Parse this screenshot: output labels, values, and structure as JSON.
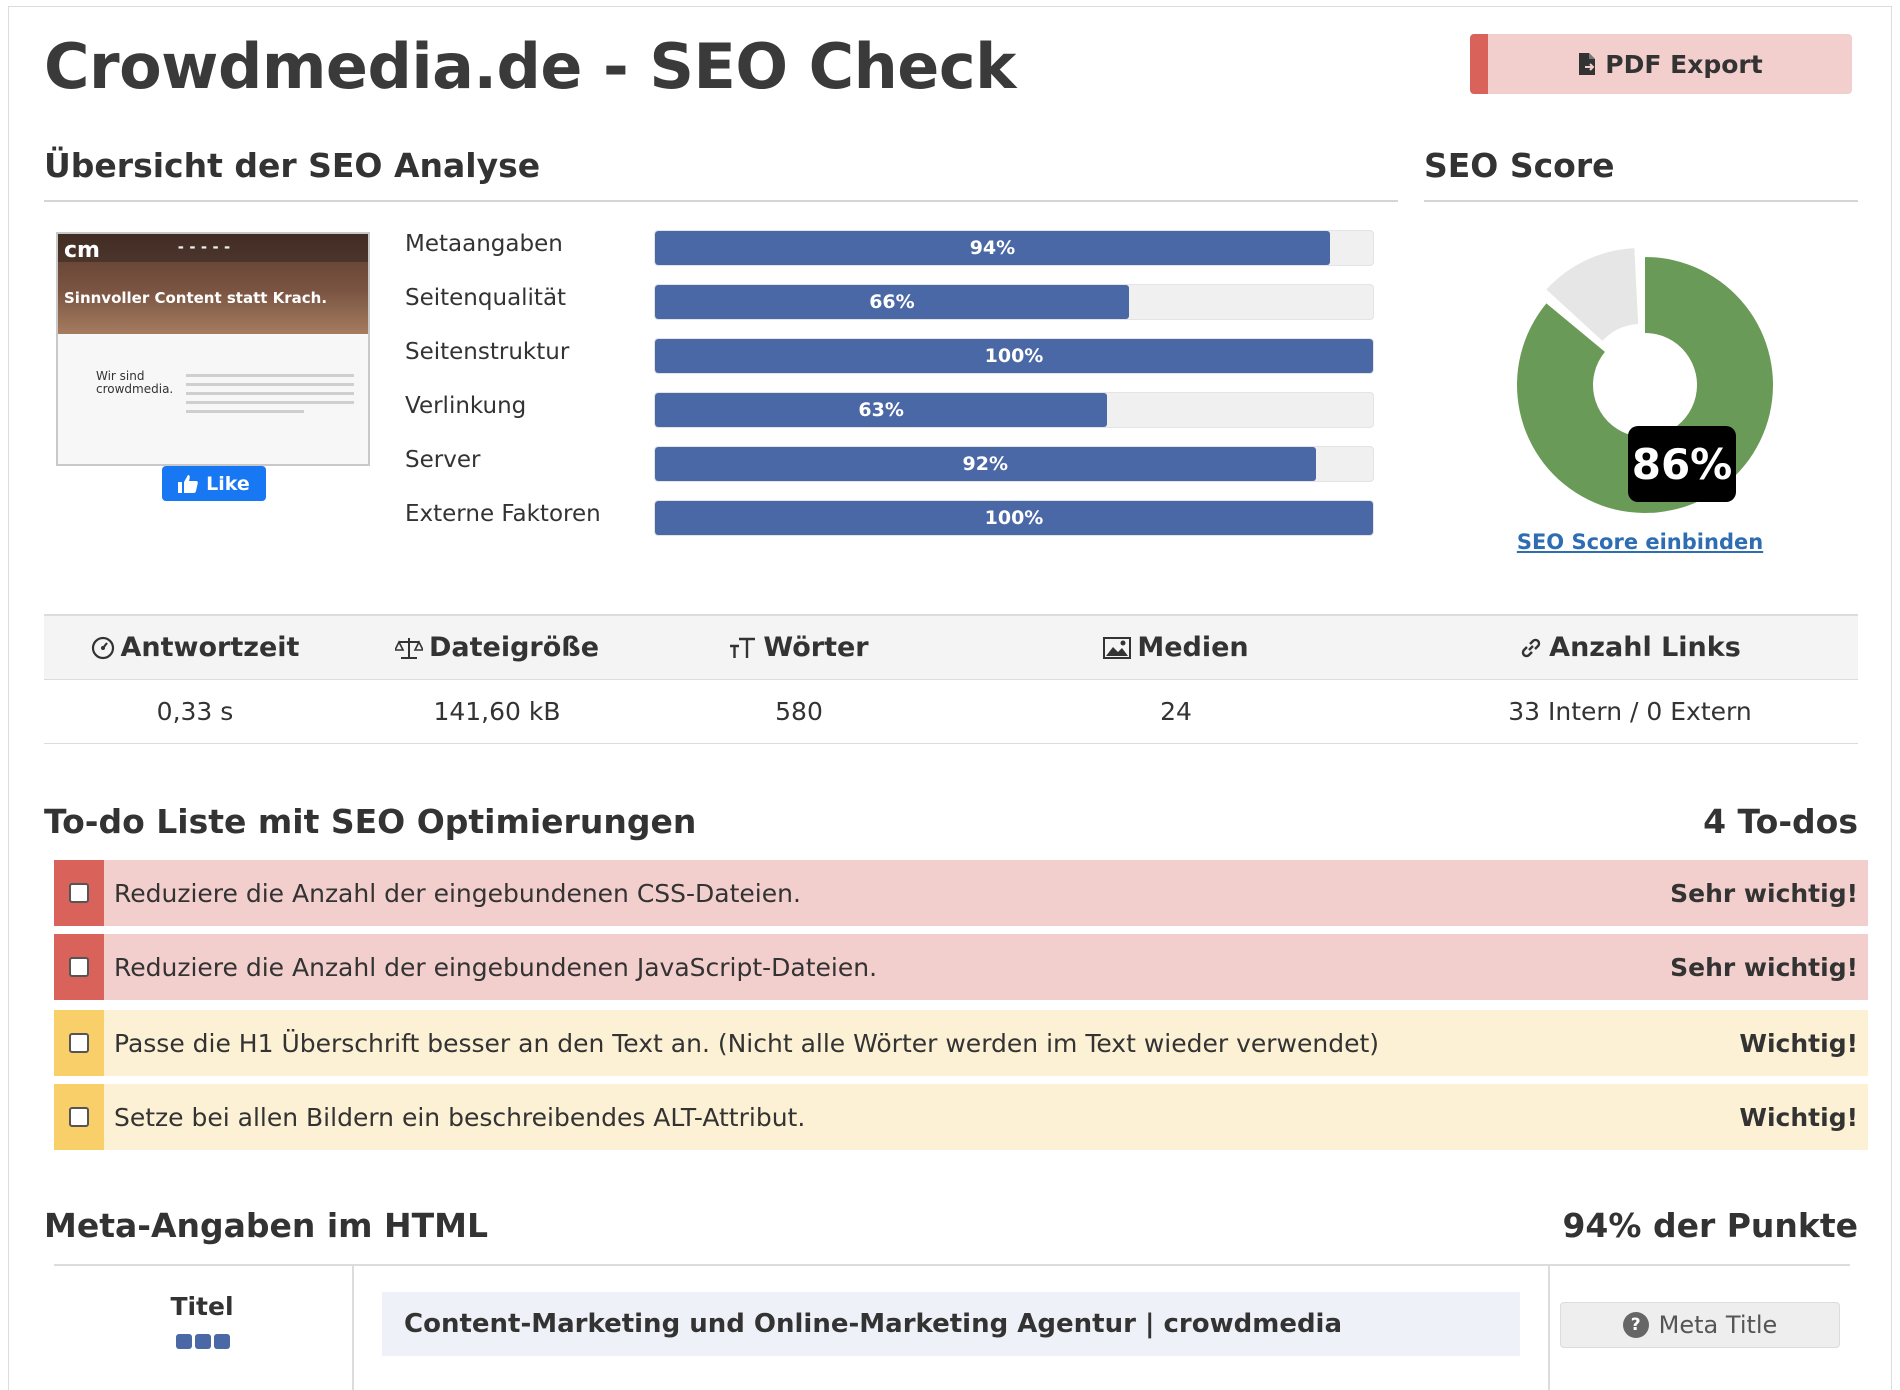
{
  "header": {
    "title": "Crowdmedia.de - SEO Check",
    "pdf_export_label": "PDF Export"
  },
  "overview": {
    "heading": "Übersicht der SEO Analyse",
    "thumbnail": {
      "logo": "cm",
      "headline": "Sinnvoller Content statt Krach.",
      "card_text": "Wir sind crowdmedia."
    },
    "like_label": "Like",
    "bars": [
      {
        "label": "Metaangaben",
        "value": 94,
        "text": "94%"
      },
      {
        "label": "Seitenqualität",
        "value": 66,
        "text": "66%"
      },
      {
        "label": "Seitenstruktur",
        "value": 100,
        "text": "100%"
      },
      {
        "label": "Verlinkung",
        "value": 63,
        "text": "63%"
      },
      {
        "label": "Server",
        "value": 92,
        "text": "92%"
      },
      {
        "label": "Externe Faktoren",
        "value": 100,
        "text": "100%"
      }
    ]
  },
  "score": {
    "heading": "SEO Score",
    "value": 86,
    "text": "86%",
    "embed_link": "SEO Score einbinden",
    "colors": {
      "filled": "#6a9a58",
      "empty": "#e6e6e6"
    }
  },
  "stats": {
    "headers": [
      {
        "icon": "gauge-icon",
        "label": "Antwortzeit"
      },
      {
        "icon": "scale-icon",
        "label": "Dateigröße"
      },
      {
        "icon": "text-size-icon",
        "label": "Wörter"
      },
      {
        "icon": "image-icon",
        "label": "Medien"
      },
      {
        "icon": "link-icon",
        "label": "Anzahl Links"
      }
    ],
    "values": [
      "0,33 s",
      "141,60 kB",
      "580",
      "24",
      "33 Intern / 0 Extern"
    ]
  },
  "todos": {
    "heading": "To-do Liste mit SEO Optimierungen",
    "count": "4 To-dos",
    "items": [
      {
        "text": "Reduziere die Anzahl der eingebundenen CSS-Dateien.",
        "priority": "Sehr wichtig!",
        "level": "red"
      },
      {
        "text": "Reduziere die Anzahl der eingebundenen JavaScript-Dateien.",
        "priority": "Sehr wichtig!",
        "level": "red"
      },
      {
        "text": "Passe die H1 Überschrift besser an den Text an. (Nicht alle Wörter werden im Text wieder verwendet)",
        "priority": "Wichtig!",
        "level": "yellow"
      },
      {
        "text": "Setze bei allen Bildern ein beschreibendes ALT-Attribut.",
        "priority": "Wichtig!",
        "level": "yellow"
      }
    ]
  },
  "meta": {
    "heading": "Meta-Angaben im HTML",
    "points": "94% der Punkte",
    "row_label": "Titel",
    "rating": 3,
    "title_value": "Content-Marketing und Online-Marketing Agentur | crowdmedia",
    "button_label": "Meta Title"
  },
  "colors": {
    "bar": "#4a67a6",
    "danger": "#d9625a",
    "danger_bg": "#f2cfcd",
    "warning": "#f9cf6a",
    "warning_bg": "#fdf1d5",
    "link": "#2e6db2"
  }
}
